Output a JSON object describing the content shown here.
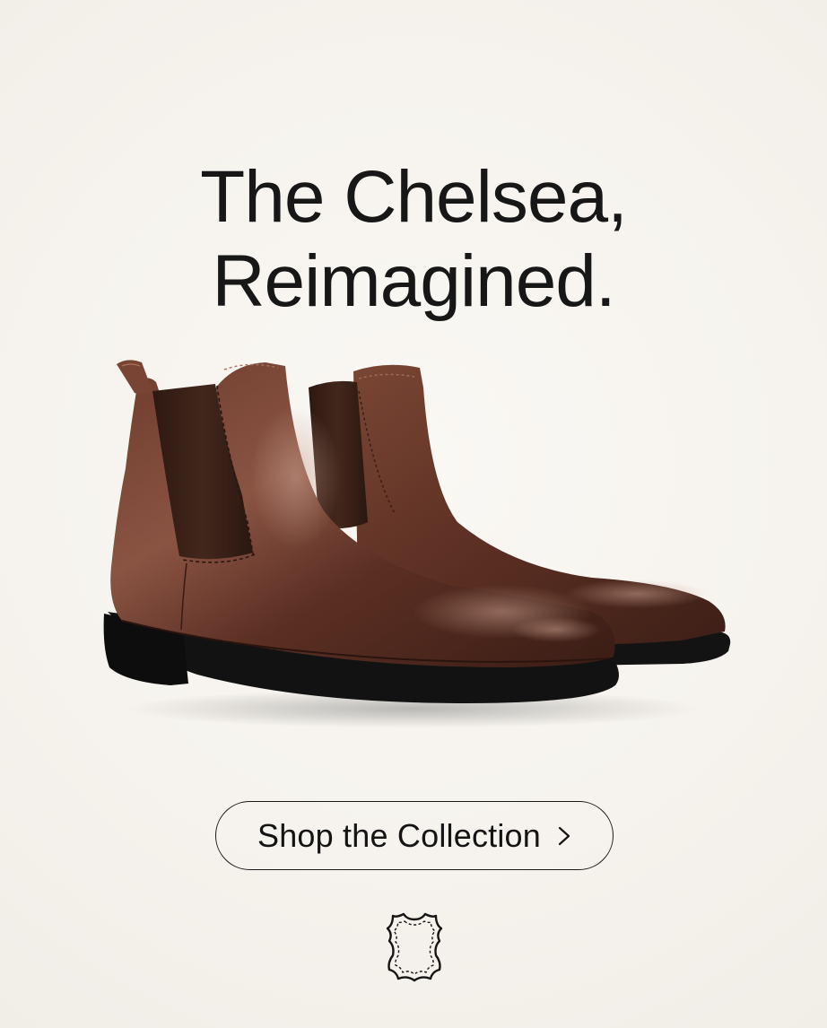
{
  "hero": {
    "headline_line1": "The Chelsea,",
    "headline_line2": "Reimagined."
  },
  "product": {
    "image_alt": "Pair of brown leather Chelsea boots with dark elastic side panels and black rubber soles",
    "leather_color": "#5a2e22",
    "elastic_color": "#3a2118",
    "sole_color": "#121212"
  },
  "cta": {
    "label": "Shop the Collection",
    "icon": "chevron-right-icon"
  },
  "badge": {
    "icon": "leather-hide-icon"
  },
  "colors": {
    "background": "#f6f3ee",
    "text": "#161616",
    "button_border": "#1a1a1a"
  }
}
